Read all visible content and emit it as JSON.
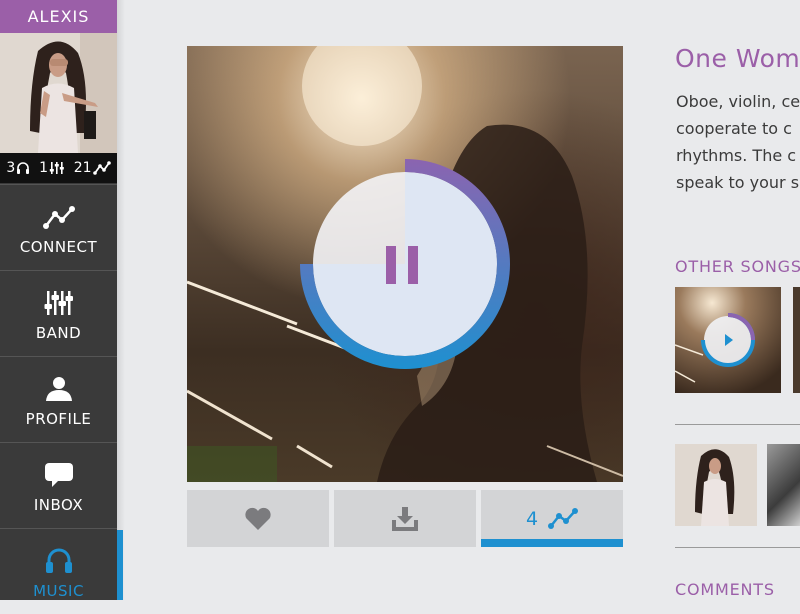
{
  "user": {
    "name": "ALEXIS",
    "stats": [
      {
        "value": "3",
        "icon": "headphones-icon"
      },
      {
        "value": "1",
        "icon": "equalizer-icon"
      },
      {
        "value": "21",
        "icon": "connect-icon"
      }
    ]
  },
  "nav": [
    {
      "label": "CONNECT",
      "icon": "connect-icon"
    },
    {
      "label": "BAND",
      "icon": "equalizer-icon"
    },
    {
      "label": "PROFILE",
      "icon": "profile-icon"
    },
    {
      "label": "INBOX",
      "icon": "chat-bubble-icon"
    },
    {
      "label": "MUSIC",
      "icon": "headphones-icon",
      "active": true
    }
  ],
  "player": {
    "state": "playing",
    "progress": 0.75,
    "buffered": 0.75
  },
  "actions": {
    "like_icon": "heart-icon",
    "download_icon": "download-icon",
    "connect_count": "4",
    "connect_icon": "connect-icon"
  },
  "song": {
    "title": "One Woma",
    "description": [
      "Oboe, violin, ce",
      "cooperate to c",
      "rhythms. The c",
      "speak to your s"
    ]
  },
  "sections": {
    "other_songs": "OTHER SONGS",
    "comments": "COMMENTS"
  },
  "colors": {
    "accent_purple": "#9b5fa8",
    "accent_blue": "#1e90d0",
    "sidebar_bg": "#3a3a3a"
  }
}
